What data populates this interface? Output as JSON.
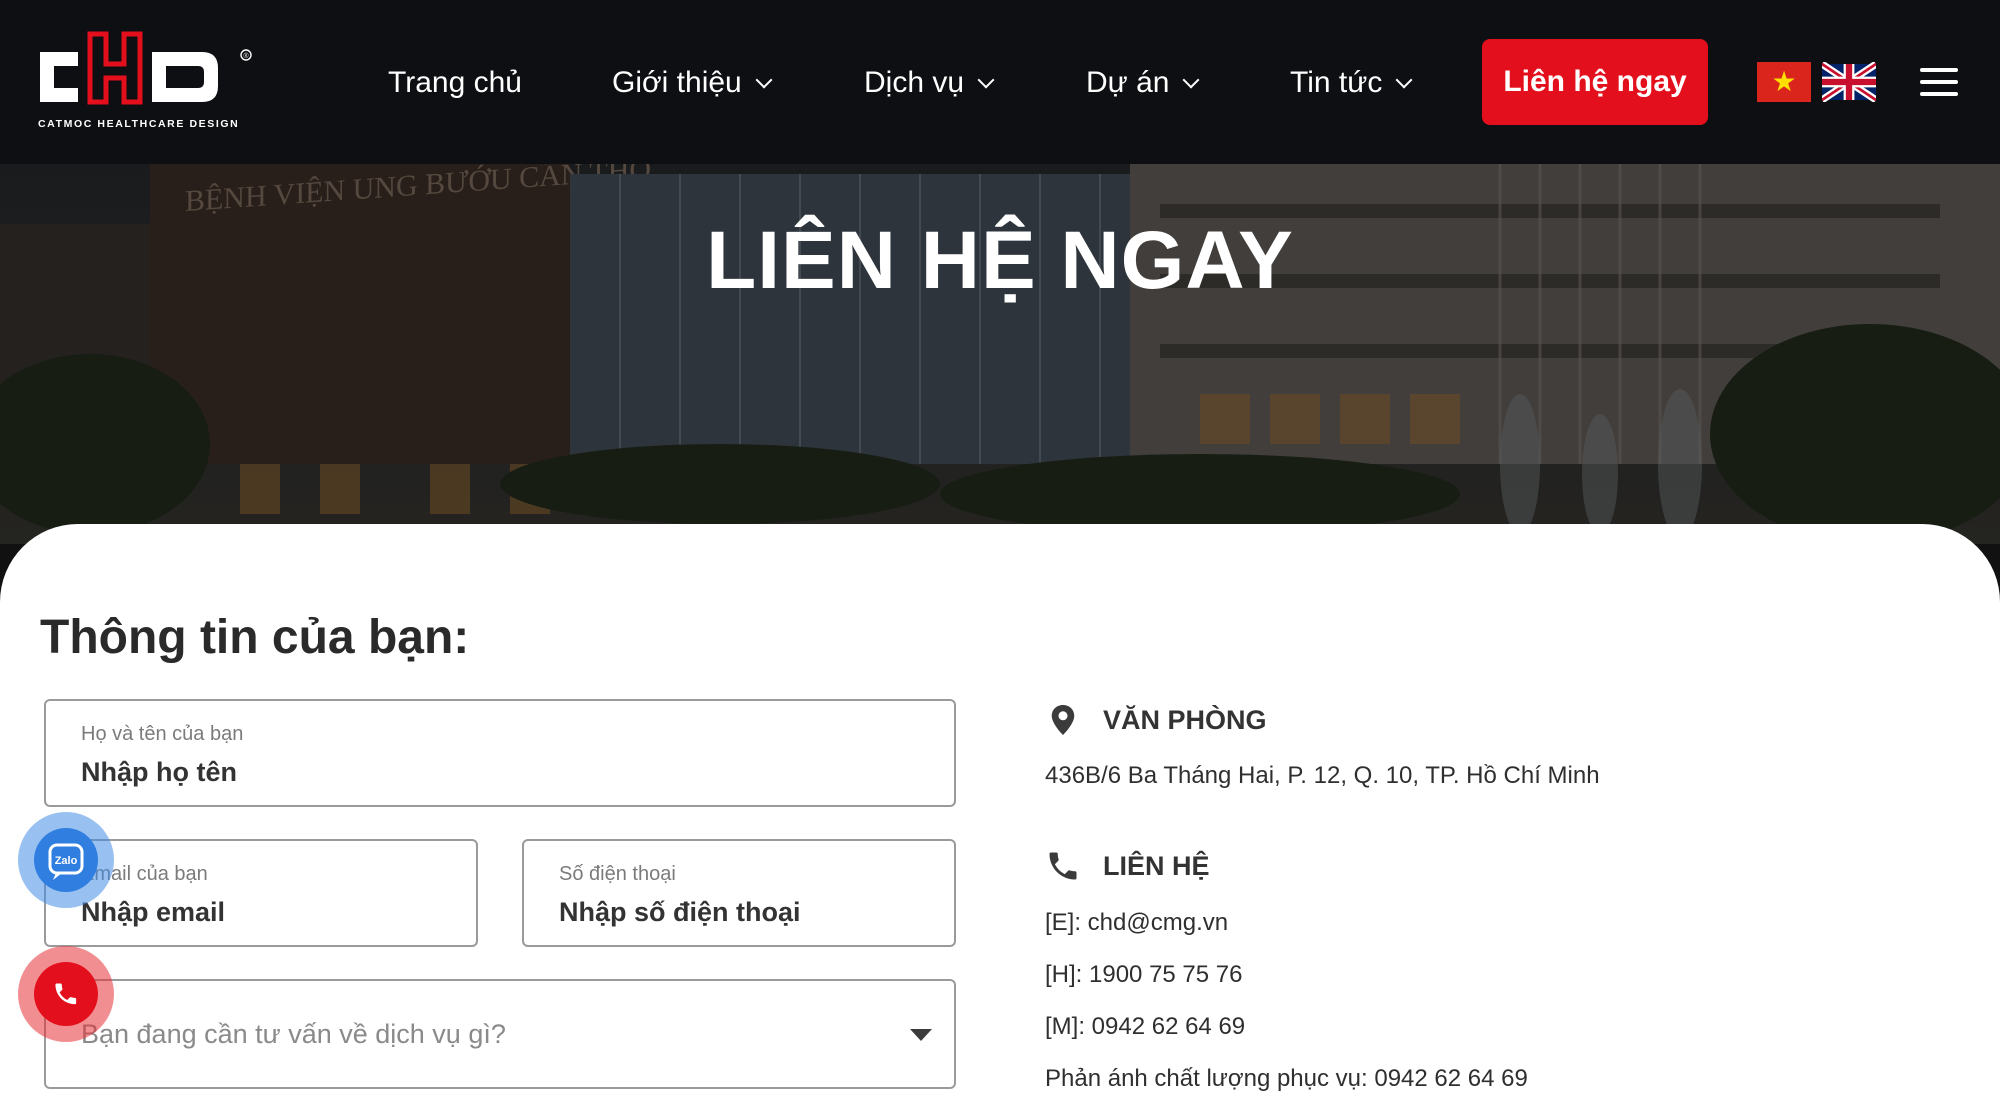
{
  "brand": {
    "logo_text": "cHD",
    "tagline": "CATMOC HEALTHCARE DESIGN",
    "registered": "®"
  },
  "nav": {
    "items": [
      {
        "label": "Trang chủ",
        "has_dropdown": false
      },
      {
        "label": "Giới thiệu",
        "has_dropdown": true
      },
      {
        "label": "Dịch vụ",
        "has_dropdown": true
      },
      {
        "label": "Dự án",
        "has_dropdown": true
      },
      {
        "label": "Tin tức",
        "has_dropdown": true
      }
    ],
    "cta_label": "Liên hệ ngay",
    "languages": [
      "vietnam-flag-icon",
      "uk-flag-icon"
    ],
    "menu_icon": "hamburger-icon"
  },
  "hero": {
    "title": "LIÊN HỆ NGAY",
    "background_sign": "BỆNH VIỆN UNG BƯỚU CẦN THƠ"
  },
  "form": {
    "title": "Thông tin của bạn:",
    "name": {
      "label": "Họ và tên của bạn",
      "placeholder": "Nhập họ tên"
    },
    "email": {
      "label": "Email của bạn",
      "placeholder": "Nhập email"
    },
    "phone": {
      "label": "Số điện thoại",
      "placeholder": "Nhập số điện thoại"
    },
    "service": {
      "placeholder": "Bạn đang cần tư vấn về dịch vụ gì?"
    }
  },
  "contact": {
    "office_heading": "VĂN PHÒNG",
    "office_address": "436B/6 Ba Tháng Hai, P. 12, Q. 10, TP. Hồ Chí Minh",
    "contact_heading": "LIÊN HỆ",
    "email_line": "[E]: chd@cmg.vn",
    "hotline_line": "[H]: 1900 75 75 76",
    "mobile_line": "[M]: 0942 62 64 69",
    "feedback_line": "Phản ánh chất lượng phục vụ: 0942 62 64 69"
  },
  "floating": {
    "zalo_label": "Zalo"
  },
  "colors": {
    "header_bg": "#0d0f12",
    "accent_red": "#e30f1c",
    "zalo_blue": "#2f7ee0"
  }
}
